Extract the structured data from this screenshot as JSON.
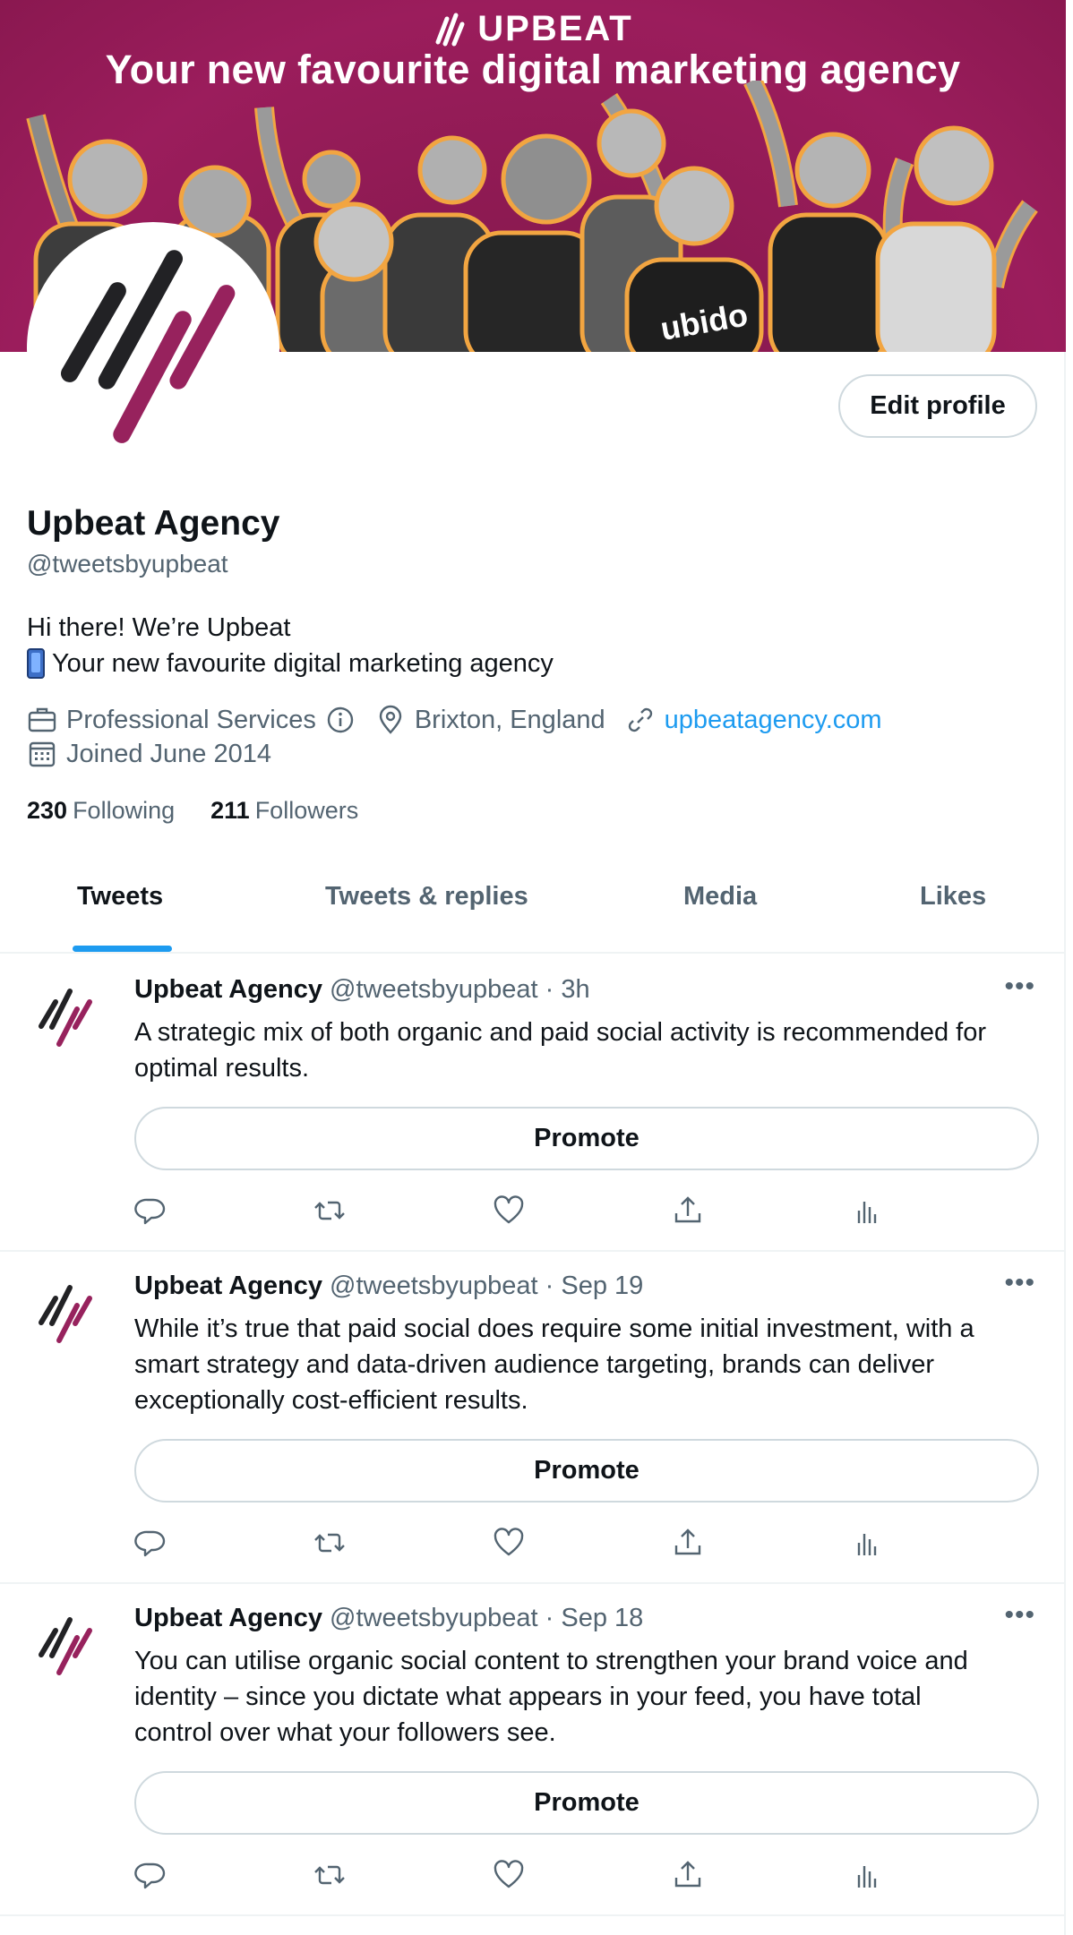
{
  "banner": {
    "brand": "UPBEAT",
    "tagline": "Your new favourite digital marketing agency",
    "shirt_text": "ubido"
  },
  "profile": {
    "edit_label": "Edit profile",
    "display_name": "Upbeat Agency",
    "handle": "@tweetsbyupbeat",
    "bio_line1": "Hi there! We’re Upbeat",
    "bio_line2": "Your new favourite digital marketing agency",
    "category": "Professional Services",
    "location": "Brixton, England",
    "website": "upbeatagency.com",
    "joined": "Joined June 2014",
    "following_count": "230",
    "following_label": "Following",
    "followers_count": "211",
    "followers_label": "Followers"
  },
  "tabs": [
    {
      "label": "Tweets",
      "active": true
    },
    {
      "label": "Tweets & replies",
      "active": false
    },
    {
      "label": "Media",
      "active": false
    },
    {
      "label": "Likes",
      "active": false
    }
  ],
  "tweets": [
    {
      "name": "Upbeat Agency",
      "handle_time": "@tweetsbyupbeat · 3h",
      "line1": "A strategic mix of both organic and paid social activity is recommended for",
      "line2": "optimal results.",
      "line3": "",
      "promote": "Promote"
    },
    {
      "name": "Upbeat Agency",
      "handle_time": "@tweetsbyupbeat · Sep 19",
      "line1": "While it’s true that paid social does require some initial investment, with a",
      "line2": "smart strategy and data-driven audience targeting, brands can deliver",
      "line3": "exceptionally cost-efficient results.",
      "promote": "Promote"
    },
    {
      "name": "Upbeat Agency",
      "handle_time": "@tweetsbyupbeat · Sep 18",
      "line1": "You can utilise organic social content to strengthen your brand voice and",
      "line2": "identity – since you dictate what appears in your feed, you have total",
      "line3": "control over what your followers see.",
      "promote": "Promote"
    }
  ],
  "colors": {
    "accent": "#1d9bf0",
    "brand_magenta": "#9b1d5c",
    "text_secondary": "#536471"
  }
}
